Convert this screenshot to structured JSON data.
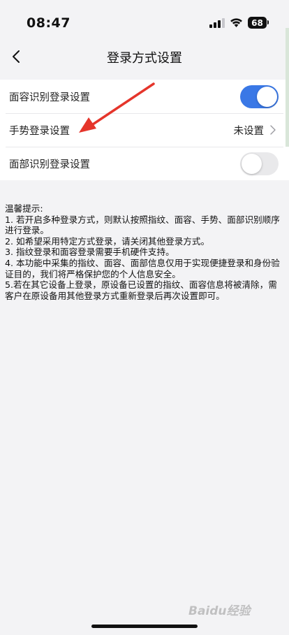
{
  "status_bar": {
    "time": "08:47",
    "battery": "68",
    "icons": [
      "signal-icon",
      "wifi-icon",
      "battery-icon"
    ]
  },
  "nav": {
    "back_icon": "chevron-left-icon",
    "title": "登录方式设置"
  },
  "settings": [
    {
      "label": "面容识别登录设置",
      "control": "toggle",
      "checked": true
    },
    {
      "label": "手势登录设置",
      "control": "link",
      "value": "未设置"
    },
    {
      "label": "面部识别登录设置",
      "control": "toggle",
      "checked": false
    }
  ],
  "tips": {
    "heading": "温馨提示:",
    "items": [
      "1. 若开启多种登录方式，则默认按照指纹、面容、手势、面部识别顺序进行登录。",
      "2. 如希望采用特定方式登录，请关闭其他登录方式。",
      "3. 指纹登录和面容登录需要手机硬件支持。",
      "4. 本功能中采集的指纹、面容、面部信息仅用于实现便捷登录和身份验证目的，我们将严格保护您的个人信息安全。",
      "5.若在其它设备上登录，原设备已设置的指纹、面容信息将被清除，需客户在原设备用其他登录方式重新登录后再次设置即可。"
    ]
  },
  "annotation": {
    "arrow_color": "#e5352b"
  },
  "watermark": "Baidu经验",
  "colors": {
    "accent": "#3a78e6",
    "background": "#f3f3f5"
  }
}
